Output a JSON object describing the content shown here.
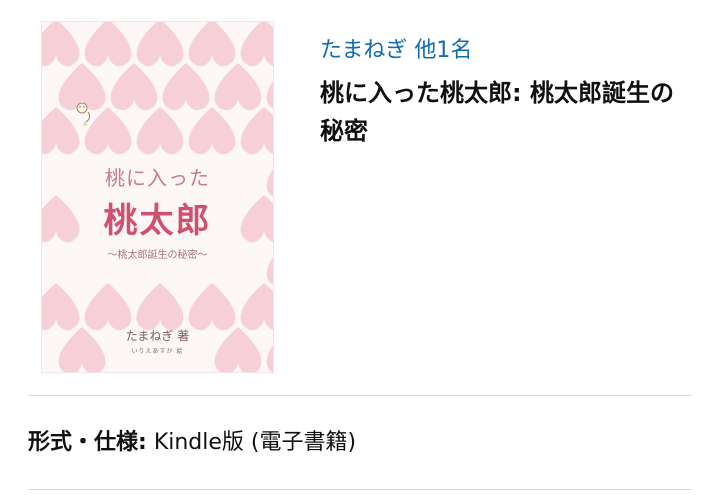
{
  "book": {
    "author_link": "たまねぎ 他1名",
    "title": "桃に入った桃太郎: 桃太郎誕生の秘密",
    "format_label": "形式・仕様:",
    "format_value": "Kindle版 (電子書籍)"
  },
  "cover": {
    "title_line1": "桃に入った",
    "title_line2": "桃太郎",
    "subtitle": "〜桃太郎誕生の秘密〜",
    "author": "たまねぎ 著",
    "illustrator": "いりえあすか 絵",
    "heart_color": "#f6c9d1",
    "accent_color": "#d2506f"
  },
  "colors": {
    "link": "#0f6db0",
    "text": "#111111",
    "divider": "#d8d8d8"
  }
}
